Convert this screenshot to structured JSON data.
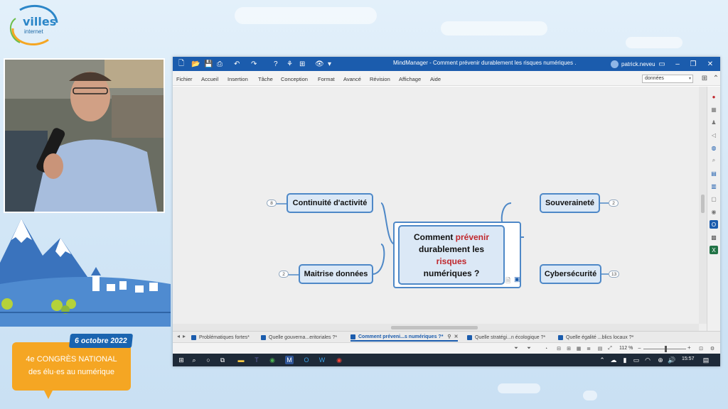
{
  "logo": {
    "line1": "villes",
    "line2": "internet"
  },
  "event": {
    "date": "6 octobre 2022",
    "line1": "4e CONGRÈS NATIONAL",
    "line2": "des élu·es au numérique",
    "color": "#f5a623",
    "date_color": "#1a64b0"
  },
  "window": {
    "title": "MindManager - Comment prévenir durablement les risques numériques .",
    "user": "patrick.neveu",
    "title_color": "#1b5cad"
  },
  "menu": [
    "Fichier",
    "Accueil",
    "Insertion",
    "Tâche",
    "Conception",
    "Format",
    "Avancé",
    "Révision",
    "Affichage",
    "Aide"
  ],
  "search": {
    "value": "données"
  },
  "map": {
    "central": {
      "line1_a": "Comment ",
      "line1_b": "prévenir",
      "line2": "durablement les",
      "line3": "risques",
      "line4": "numériques ?"
    },
    "left_topics": [
      {
        "label": "Continuité d'activité",
        "count": "8"
      },
      {
        "label": "Maitrise données",
        "count": "2"
      }
    ],
    "right_topics": [
      {
        "label": "Souveraineté",
        "count": "2"
      },
      {
        "label": "Cybersécurité",
        "count": "13"
      }
    ]
  },
  "doc_tabs": [
    {
      "label": "Problématiques fortes*",
      "active": false
    },
    {
      "label": "Quelle gouverna...eritoriales ?*",
      "active": false
    },
    {
      "label": "Comment préveni...s numériques ?*",
      "active": true
    },
    {
      "label": "Quelle stratégi...n écologique ?*",
      "active": false
    },
    {
      "label": "Quelle égalité ...blics locaux ?*",
      "active": false
    }
  ],
  "status": {
    "zoom": "112 %"
  },
  "taskbar": {
    "time": "15:57"
  }
}
